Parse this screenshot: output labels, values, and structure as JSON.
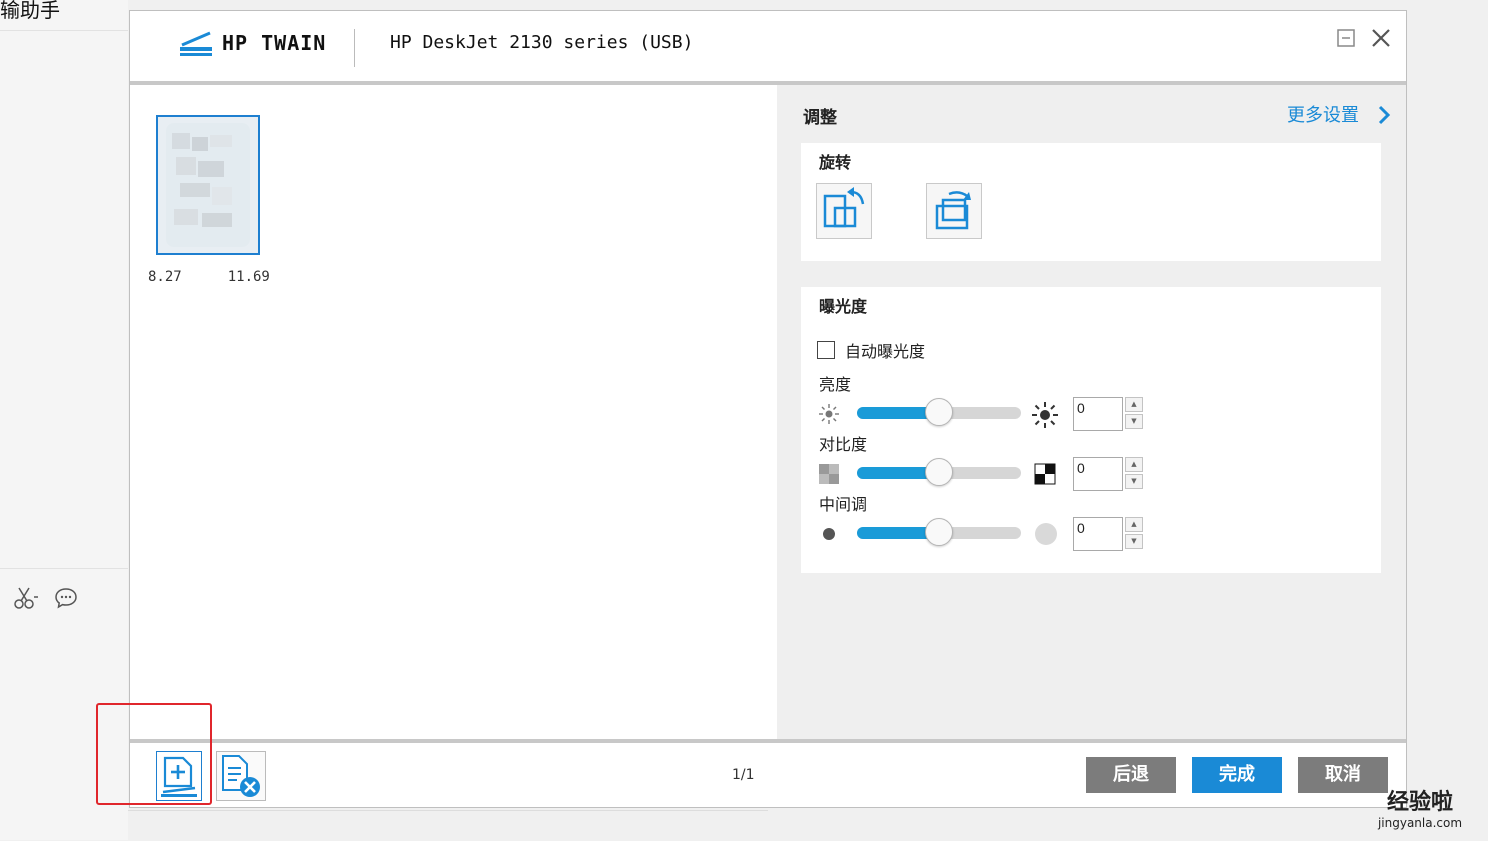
{
  "background_app": {
    "title": "输助手"
  },
  "dialog": {
    "brand": "HP TWAIN",
    "device": "HP DeskJet 2130 series (USB)"
  },
  "preview": {
    "thumbnail_size_left": "8.27",
    "thumbnail_size_right": "11.69"
  },
  "adjust": {
    "title": "调整",
    "more_settings": "更多设置",
    "rotate": {
      "title": "旋转"
    },
    "exposure": {
      "title": "曝光度",
      "auto_label": "自动曝光度",
      "auto_checked": false,
      "brightness": {
        "label": "亮度",
        "value": "0",
        "level": 0.5
      },
      "contrast": {
        "label": "对比度",
        "value": "0",
        "level": 0.5
      },
      "midtone": {
        "label": "中间调",
        "value": "0",
        "level": 0.5
      }
    }
  },
  "footer": {
    "page_count": "1/1",
    "back": "后退",
    "done": "完成",
    "cancel": "取消"
  },
  "colors": {
    "accent": "#1a8ad6",
    "slider_fill": "#1a9bd8",
    "gray_button": "#7c7c7c",
    "highlight": "#e0262c"
  },
  "watermark": {
    "text": "经验啦",
    "url": "jingyanla.com"
  }
}
